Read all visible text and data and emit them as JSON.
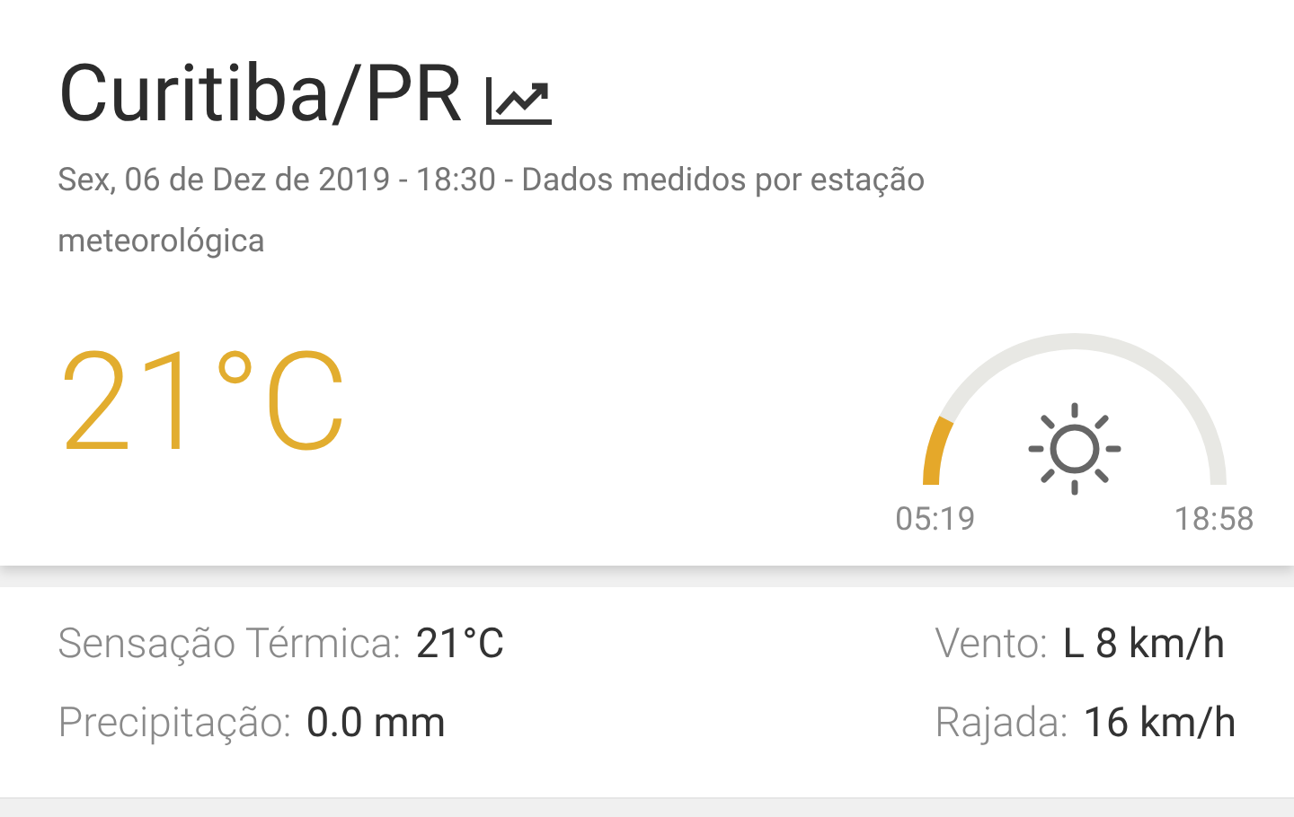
{
  "location": {
    "title": "Curitiba/PR",
    "subtitle": "Sex, 06 de Dez de 2019 - 18:30 - Dados medidos por estação meteorológica"
  },
  "temperature": "21°C",
  "sun": {
    "sunrise": "05:19",
    "sunset": "18:58"
  },
  "details_left": [
    {
      "label": "Sensação Térmica:",
      "value": "21°C"
    },
    {
      "label": "Precipitação:",
      "value": "0.0 mm"
    }
  ],
  "details_right": [
    {
      "label": "Vento:",
      "value": "L 8 km/h"
    },
    {
      "label": "Rajada:",
      "value": "16 km/h"
    }
  ]
}
